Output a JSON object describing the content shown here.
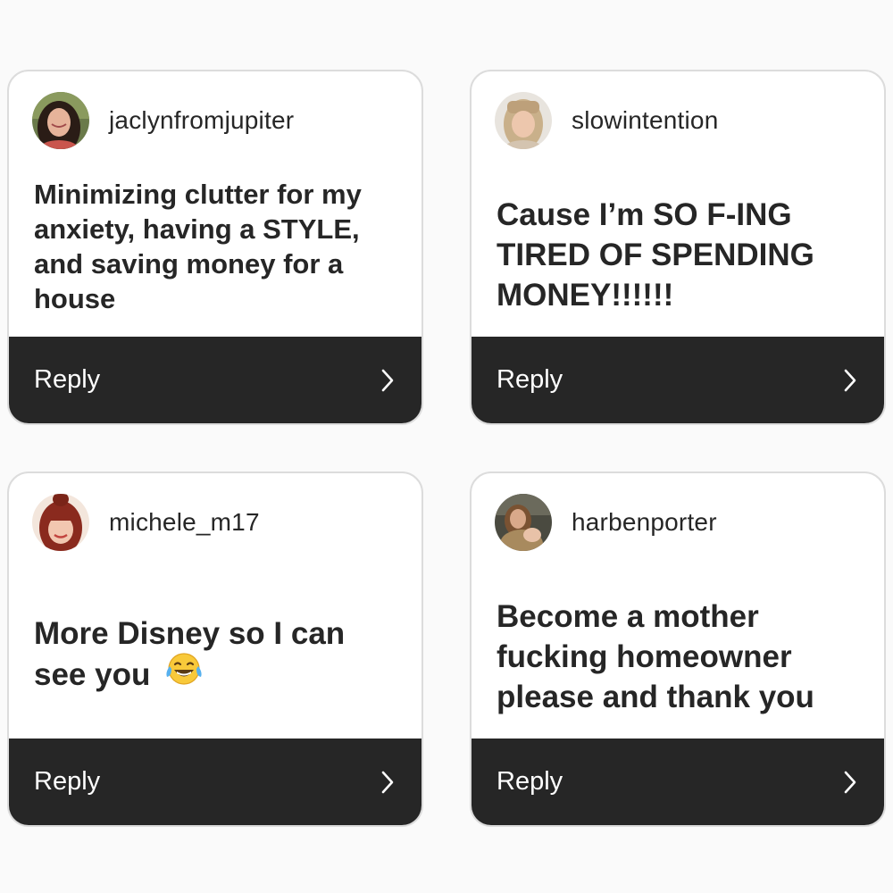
{
  "cards": [
    {
      "username": "jaclynfromjupiter",
      "message": "Minimizing clutter for my\nanxiety, having a STYLE,\nand saving money for a\nhouse",
      "reply_label": "Reply",
      "avatar": "avatar-photo-dark-hair-woman"
    },
    {
      "username": "slowintention",
      "message": "Cause I’m SO F-ING\nTIRED OF SPENDING\nMONEY!!!!!!",
      "reply_label": "Reply",
      "avatar": "avatar-photo-blonde-woman-bangs"
    },
    {
      "username": "michele_m17",
      "message": "More Disney so I can\nsee you",
      "emoji": "face-with-tears-of-joy",
      "reply_label": "Reply",
      "avatar": "avatar-photo-red-hair-woman"
    },
    {
      "username": "harbenporter",
      "message": "Become a mother\nfucking homeowner\nplease and thank you",
      "reply_label": "Reply",
      "avatar": "avatar-photo-woman-holding-baby"
    }
  ],
  "colors": {
    "page_background": "#fafafa",
    "card_background": "#ffffff",
    "card_border": "#dcdcdc",
    "reply_bar": "#262626",
    "text": "#262626",
    "reply_text": "#ffffff"
  }
}
